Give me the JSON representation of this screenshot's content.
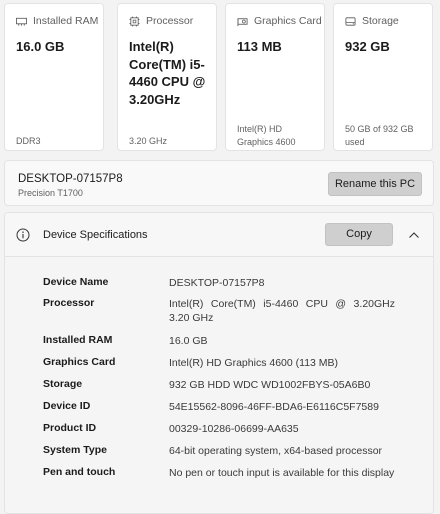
{
  "cards": [
    {
      "icon": "memory-icon",
      "title": "Installed RAM",
      "value": "16.0 GB",
      "sub": "DDR3"
    },
    {
      "icon": "processor-icon",
      "title": "Processor",
      "value": "Intel(R) Core(TM) i5-4460  CPU @ 3.20GHz",
      "sub": "3.20 GHz"
    },
    {
      "icon": "graphics-card-icon",
      "title": "Graphics Card",
      "value": "113 MB",
      "sub": "Intel(R) HD Graphics 4600"
    },
    {
      "icon": "storage-icon",
      "title": "Storage",
      "value": "932 GB",
      "sub": "50 GB of 932 GB used"
    }
  ],
  "pc": {
    "name": "DESKTOP-07157P8",
    "model": "Precision T1700",
    "rename_label": "Rename this PC"
  },
  "specs": {
    "title": "Device Specifications",
    "copy_label": "Copy",
    "rows": [
      {
        "label": "Device Name",
        "value": "DESKTOP-07157P8"
      },
      {
        "label": "Processor",
        "value": "Intel(R) Core(TM) i5-4460 CPU @ 3.20GHz 3.20 GHz"
      },
      {
        "label": "Installed RAM",
        "value": "16.0 GB"
      },
      {
        "label": "Graphics Card",
        "value": "Intel(R) HD Graphics 4600 (113 MB)"
      },
      {
        "label": "Storage",
        "value": "932 GB HDD WDC WD1002FBYS-05A6B0"
      },
      {
        "label": "Device ID",
        "value": "54E15562-8096-46FF-BDA6-E6116C5F7589"
      },
      {
        "label": "Product ID",
        "value": "00329-10286-06699-AA635"
      },
      {
        "label": "System Type",
        "value": "64-bit operating system, x64-based processor"
      },
      {
        "label": "Pen and touch",
        "value": "No pen or touch input is available for this display"
      }
    ]
  }
}
